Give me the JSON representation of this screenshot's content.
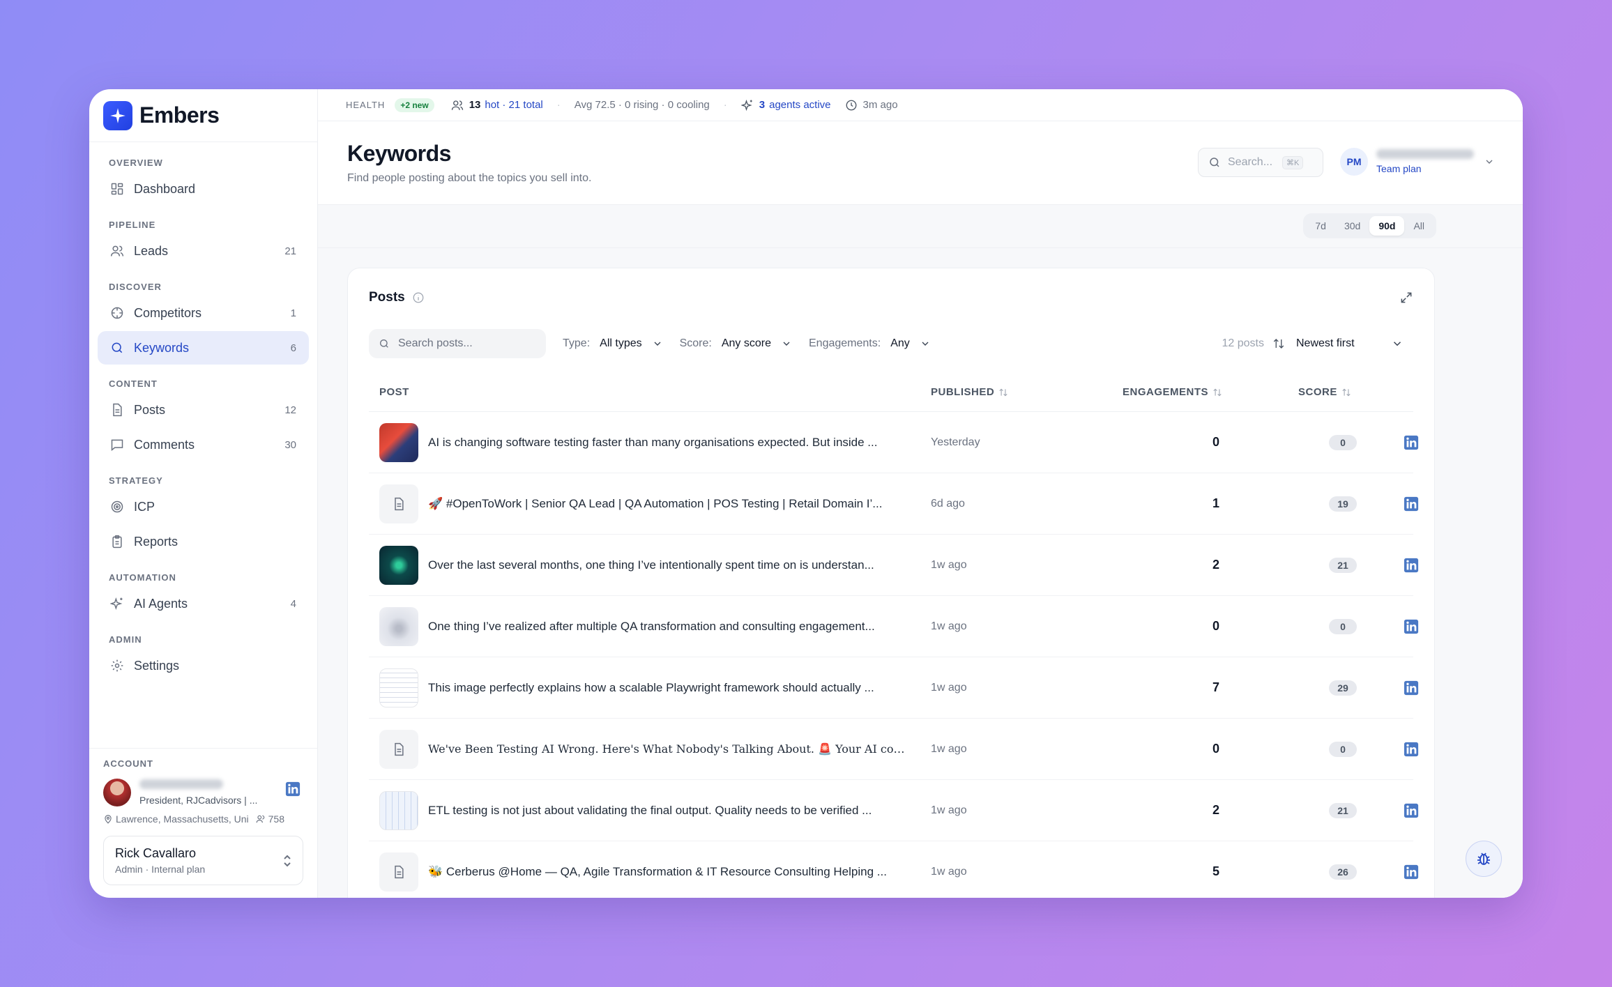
{
  "brand": {
    "name": "Embers"
  },
  "sidebar": {
    "sections": [
      {
        "label": "OVERVIEW",
        "items": [
          {
            "label": "Dashboard",
            "count": ""
          }
        ]
      },
      {
        "label": "PIPELINE",
        "items": [
          {
            "label": "Leads",
            "count": "21"
          }
        ]
      },
      {
        "label": "DISCOVER",
        "items": [
          {
            "label": "Competitors",
            "count": "1"
          },
          {
            "label": "Keywords",
            "count": "6"
          }
        ]
      },
      {
        "label": "CONTENT",
        "items": [
          {
            "label": "Posts",
            "count": "12"
          },
          {
            "label": "Comments",
            "count": "30"
          }
        ]
      },
      {
        "label": "STRATEGY",
        "items": [
          {
            "label": "ICP",
            "count": ""
          },
          {
            "label": "Reports",
            "count": ""
          }
        ]
      },
      {
        "label": "AUTOMATION",
        "items": [
          {
            "label": "AI Agents",
            "count": "4"
          }
        ]
      },
      {
        "label": "ADMIN",
        "items": [
          {
            "label": "Settings",
            "count": ""
          }
        ]
      }
    ],
    "account": {
      "label": "ACCOUNT",
      "title": "President, RJCadvisors | ...",
      "location": "Lawrence, Massachusetts, Uni",
      "followers": "758"
    },
    "user": {
      "name": "Rick Cavallaro",
      "sub": "Admin · Internal plan"
    }
  },
  "topbar": {
    "health": "HEALTH",
    "new_badge": "+2 new",
    "hot_count": "13",
    "hot_text": "hot · 21 total",
    "avg_text": "Avg 72.5 · 0 rising · 0 cooling",
    "agents_count": "3",
    "agents_text": "agents active",
    "updated": "3m ago"
  },
  "header": {
    "title": "Keywords",
    "subtitle": "Find people posting about the topics you sell into.",
    "search_placeholder": "Search...",
    "search_kbd": "⌘K",
    "initials": "PM",
    "plan": "Team plan"
  },
  "ranges": [
    "7d",
    "30d",
    "90d",
    "All"
  ],
  "posts_card": {
    "title": "Posts",
    "search_placeholder": "Search posts...",
    "filters": {
      "type_label": "Type:",
      "type_value": "All types",
      "score_label": "Score:",
      "score_value": "Any score",
      "eng_label": "Engagements:",
      "eng_value": "Any"
    },
    "count": "12 posts",
    "sort": "Newest first",
    "columns": {
      "post": "POST",
      "published": "PUBLISHED",
      "engagements": "ENGAGEMENTS",
      "score": "SCORE"
    },
    "rows": [
      {
        "thumb": "img1",
        "text": "AI is changing software testing faster than many organisations expected. But inside ...",
        "published": "Yesterday",
        "engagements": "0",
        "score": "0"
      },
      {
        "thumb": "doc",
        "text": "🚀 #OpenToWork | Senior QA Lead | QA Automation | POS Testing | Retail Domain I’...",
        "published": "6d ago",
        "engagements": "1",
        "score": "19"
      },
      {
        "thumb": "img2",
        "text": "Over the last several months, one thing I’ve intentionally spent time on is understan...",
        "published": "1w ago",
        "engagements": "2",
        "score": "21"
      },
      {
        "thumb": "img3",
        "text": "One thing I’ve realized after multiple QA transformation and consulting engagement...",
        "published": "1w ago",
        "engagements": "0",
        "score": "0"
      },
      {
        "thumb": "img4",
        "text": "This image perfectly explains how a scalable Playwright framework should actually ...",
        "published": "1w ago",
        "engagements": "7",
        "score": "29"
      },
      {
        "thumb": "doc",
        "text": "We've Been Testing AI Wrong. Here's What Nobody's Talking About. 🚨 Your AI cop...",
        "published": "1w ago",
        "engagements": "0",
        "score": "0",
        "serif": true
      },
      {
        "thumb": "img5",
        "text": "ETL testing is not just about validating the final output. Quality needs to be verified ...",
        "published": "1w ago",
        "engagements": "2",
        "score": "21"
      },
      {
        "thumb": "doc",
        "text": "🐝 Cerberus @Home — QA, Agile Transformation & IT Resource Consulting Helping ...",
        "published": "1w ago",
        "engagements": "5",
        "score": "26"
      }
    ]
  },
  "colors": {
    "accent": "#2447c5",
    "linkedin": "#4a78c4"
  }
}
